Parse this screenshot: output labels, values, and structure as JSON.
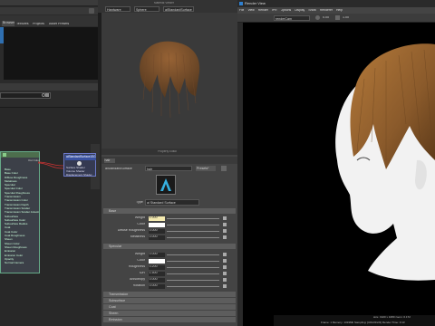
{
  "left_panel": {
    "tabs": [
      "Browser",
      "Textures",
      "Projects",
      "Asset Presets"
    ],
    "active_tab": "Browser",
    "filter_placeholder": "",
    "node_main": {
      "title": "aiStandardSurface",
      "items": [
        "Base",
        "Base Color",
        "Diffuse Roughness",
        "Metalness",
        "Specular",
        "Specular Color",
        "Specular Roughness",
        "Transmission",
        "Transmission Color",
        "Transmission Depth",
        "Transmission Scatter",
        "Transmission Scatter Anisotropy",
        "Subsurface",
        "Subsurface Color",
        "Subsurface Radius",
        "Coat",
        "Coat Color",
        "Coat Roughness",
        "Sheen",
        "Sheen Color",
        "Sheen Roughness",
        "Emission",
        "Emission Color",
        "Opacity",
        "Normal Camera"
      ]
    },
    "node_sg": {
      "title": "aiStandardSurface1SG",
      "items": [
        "Surface Shader",
        "Volume Shader",
        "Displacement Shader"
      ]
    }
  },
  "viewport": {
    "title": "Material Viewer",
    "dropdowns": [
      "Hardware",
      "Sphere",
      "aiStandardSurface"
    ]
  },
  "property_editor": {
    "title": "Property Editor",
    "tab": "hair",
    "type_label": "aiStandardSurface",
    "name_value": "hair",
    "presets_label": "Presets*",
    "type_row_label": "Type",
    "type_value": "ai Standard Surface",
    "sections": {
      "base": "Base",
      "specular": "Specular",
      "transmission": "Transmission",
      "subsurface": "Subsurface",
      "coat": "Coat",
      "sheen": "Sheen",
      "emission": "Emission"
    },
    "base_rows": [
      {
        "label": "Weight",
        "value": "1.000"
      },
      {
        "label": "Color",
        "value": ""
      },
      {
        "label": "Diffuse Roughness",
        "value": "0.000"
      },
      {
        "label": "Metalness",
        "value": "0.000"
      }
    ],
    "specular_rows": [
      {
        "label": "Weight",
        "value": "0.000"
      },
      {
        "label": "Color",
        "value": ""
      },
      {
        "label": "Roughness",
        "value": "0.200"
      },
      {
        "label": "IOR",
        "value": "1.500"
      },
      {
        "label": "Anisotropy",
        "value": "0.000"
      },
      {
        "label": "Rotation",
        "value": "0.000"
      }
    ]
  },
  "render_view": {
    "title": "Render View",
    "menu": [
      "File",
      "View",
      "Render",
      "IPR",
      "Options",
      "Display",
      "Show",
      "Renderer",
      "Help"
    ],
    "camera": "renderCam",
    "exposure": "0.00",
    "gamma": "1.00",
    "status_line1": "size: 1920 x 1080  zoom: 0.172",
    "status_line2": "Frame: 1  Memory: 1319Mb  Sampling: [3/2/2/2/2/2]  Render Time: 0:13"
  },
  "colors": {
    "hair_brown": "#8a5a2b",
    "skin_white": "#f2f2f2",
    "node_border": "#66aa88",
    "sg_header": "#3a52a0",
    "section_header": "#5d5d5d",
    "swatch_yellow": "#f4eab0"
  }
}
